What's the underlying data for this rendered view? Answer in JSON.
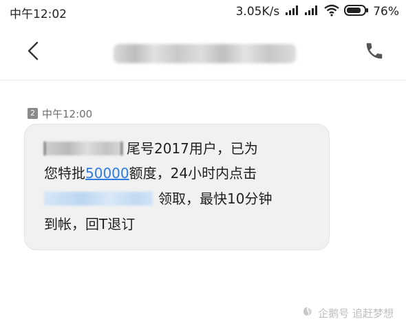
{
  "status_bar": {
    "time": "中午12:02",
    "net_speed": "3.05K/s",
    "battery": "76%"
  },
  "header": {
    "contact_name": ""
  },
  "message": {
    "sim": "2",
    "time": "中午12:00",
    "line1_text": "尾号2017用户，已为",
    "line2_prefix": "您特批",
    "line2_amount": "50000",
    "line2_suffix": "额度，24小时内点击",
    "line3_text": "领取，最快10分钟",
    "line4_text": "到帐，回T退订"
  },
  "watermark": {
    "text": "企鹅号 追赶梦想"
  },
  "colors": {
    "link": "#2d7be0",
    "bubble": "#f1f1f1",
    "icon": "#555555"
  }
}
